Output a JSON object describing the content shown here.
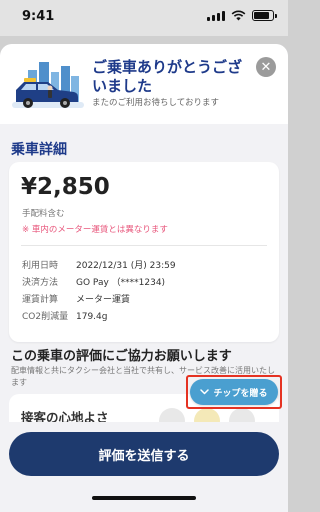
{
  "status_bar": {
    "time": "9:41"
  },
  "header": {
    "title": "ご乗車ありがとうございました",
    "subtitle": "またのご利用お待ちしております",
    "close_glyph": "✕"
  },
  "ride_details": {
    "section_title": "乗車詳細",
    "fare": "¥2,850",
    "fare_note": "手配料含む",
    "fare_warning": "※ 車内のメーター運賃とは異なります",
    "rows": [
      {
        "label": "利用日時",
        "value": "2022/12/31 (月) 23:59"
      },
      {
        "label": "決済方法",
        "value": "GO Pay （****1234)"
      },
      {
        "label": "運賃計算",
        "value": "メーター運賃"
      },
      {
        "label": "CO2削減量",
        "value": "179.4g"
      }
    ]
  },
  "evaluation": {
    "title": "この乗車の評価にご協力お願いします",
    "description": "配車情報と共にタクシー会社と当社で共有し、サービス改善に活用いたします",
    "first_item": "接客の心地よさ"
  },
  "tip_button": {
    "label": "チップを贈る",
    "icon": "chevron-down-icon"
  },
  "submit_button": {
    "label": "評価を送信する"
  },
  "colors": {
    "accent": "#1e3a6e",
    "title_blue": "#1e3a8a",
    "tip_blue": "#4a9fd0",
    "warning_pink": "#e8577c",
    "highlight_red": "#e53222"
  }
}
